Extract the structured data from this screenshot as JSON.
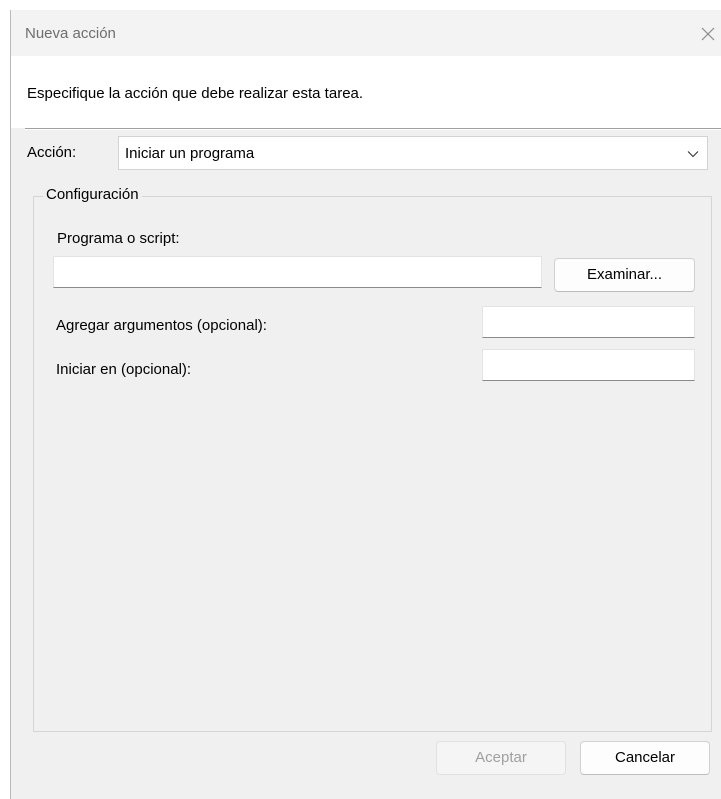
{
  "window": {
    "title": "Nueva acción",
    "close_icon": "close-icon"
  },
  "header": {
    "instruction": "Especifique la acción que debe realizar esta tarea."
  },
  "action": {
    "label": "Acción:",
    "selected": "Iniciar un programa",
    "dropdown_icon": "chevron-down-icon"
  },
  "settings": {
    "group_title": "Configuración",
    "program_label": "Programa o script:",
    "program_value": "",
    "browse_label": "Examinar...",
    "arguments_label": "Agregar argumentos (opcional):",
    "arguments_value": "",
    "start_in_label": "Iniciar en (opcional):",
    "start_in_value": ""
  },
  "footer": {
    "ok_label": "Aceptar",
    "ok_enabled": false,
    "cancel_label": "Cancelar"
  }
}
